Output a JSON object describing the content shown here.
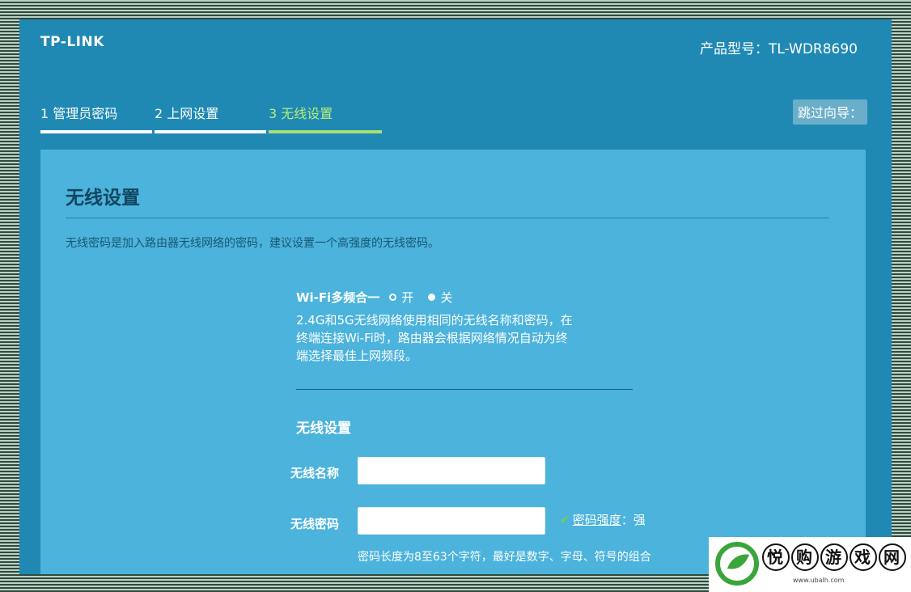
{
  "header": {
    "logo": "TP-LINK",
    "model": "产品型号：TL-WDR8690"
  },
  "steps": [
    {
      "label": "1 管理员密码",
      "active": false
    },
    {
      "label": "2 上网设置",
      "active": false
    },
    {
      "label": "3 无线设置",
      "active": true
    }
  ],
  "skip_label": "跳过向导：",
  "panel": {
    "title": "无线设置",
    "description": "无线密码是加入路由器无线网络的密码，建议设置一个高强度的无线密码。"
  },
  "wifi_merge": {
    "label": "Wi-Fi多频合一",
    "option_on": "开",
    "option_off": "关",
    "selected": "开",
    "description_lines": [
      "2.4G和5G无线网络使用相同的无线名称和密码，在",
      "终端连接Wi-Fi时，路由器会根据网络情况自动为终",
      "端选择最佳上网频段。"
    ]
  },
  "wireless": {
    "section_title": "无线设置",
    "ssid_label": "无线名称",
    "ssid_value": "",
    "password_label": "无线密码",
    "password_value": "",
    "strength_label": "密码强度",
    "strength_sep": "：",
    "strength_value": "强",
    "password_hint": "密码长度为8至63个字符，最好是数字、字母、符号的组合"
  },
  "watermark": {
    "chars": [
      "悦",
      "购",
      "游",
      "戏",
      "网"
    ],
    "url": "www.ubalh.com"
  },
  "colors": {
    "app_bg": "#1f89b4",
    "panel_bg": "#4bb3dc",
    "active_step": "#a8e070",
    "check": "#6fd24a"
  }
}
